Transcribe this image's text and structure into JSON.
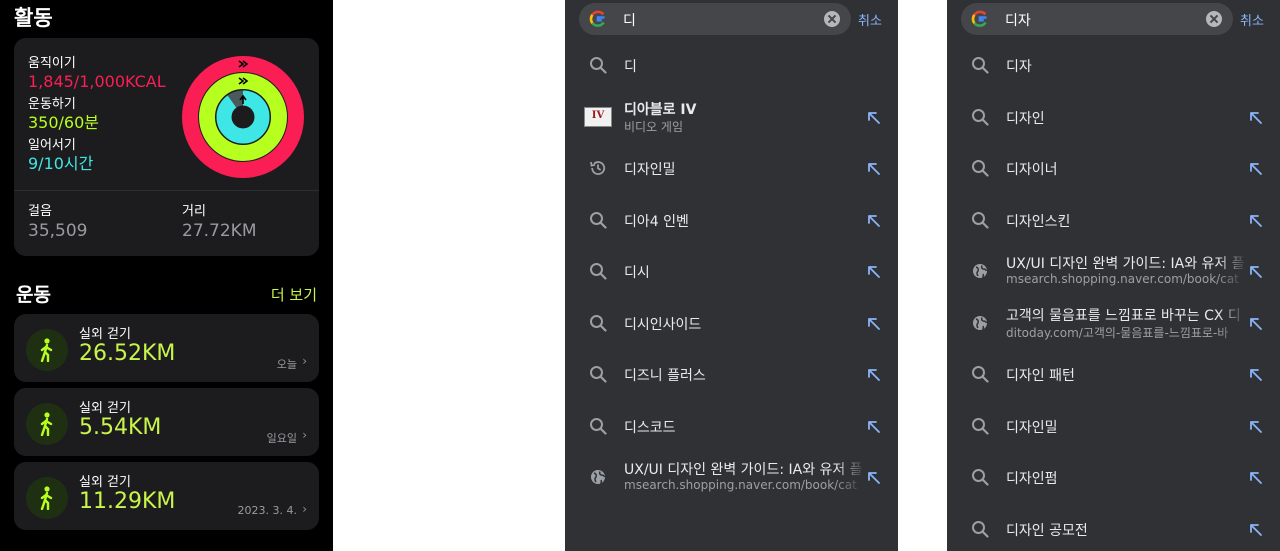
{
  "activity": {
    "title": "활동",
    "move": {
      "label": "움직이기",
      "value": "1,845/1,000KCAL",
      "color": "#fa1e55"
    },
    "exercise": {
      "label": "운동하기",
      "value": "350/60분",
      "color": "#b6ff1f"
    },
    "stand": {
      "label": "일어서기",
      "value": "9/10시간",
      "color": "#3fe6e6"
    },
    "steps": {
      "label": "걸음",
      "value": "35,509"
    },
    "distance": {
      "label": "거리",
      "value": "27.72KM"
    }
  },
  "workouts": {
    "title": "운동",
    "more": "더 보기",
    "items": [
      {
        "name": "실외 걷기",
        "distance": "26.52KM",
        "date": "오늘"
      },
      {
        "name": "실외 걷기",
        "distance": "5.54KM",
        "date": "일요일"
      },
      {
        "name": "실외 걷기",
        "distance": "11.29KM",
        "date": "2023. 3. 4."
      }
    ]
  },
  "search1": {
    "query": "디",
    "cancel": "취소",
    "suggestions": [
      {
        "icon": "search-icon",
        "text": "디"
      },
      {
        "icon": "thumbnail",
        "text": "디아블로 IV",
        "sub": "비디오 게임",
        "thumb_text": "IV"
      },
      {
        "icon": "history-icon",
        "text": "디자인밀"
      },
      {
        "icon": "search-icon",
        "text": "디아4 인벤"
      },
      {
        "icon": "search-icon",
        "text": "디시"
      },
      {
        "icon": "search-icon",
        "text": "디시인사이드"
      },
      {
        "icon": "search-icon",
        "text": "디즈니 플러스"
      },
      {
        "icon": "search-icon",
        "text": "디스코드"
      },
      {
        "icon": "globe-icon",
        "text": "UX/UI 디자인 완벽 가이드: IA와 유저 플",
        "sub": "msearch.shopping.naver.com/book/cat"
      }
    ]
  },
  "search2": {
    "query": "디자",
    "cancel": "취소",
    "suggestions": [
      {
        "icon": "search-icon",
        "text": "디자"
      },
      {
        "icon": "search-icon",
        "text": "디자인"
      },
      {
        "icon": "search-icon",
        "text": "디자이너"
      },
      {
        "icon": "search-icon",
        "text": "디자인스킨"
      },
      {
        "icon": "globe-icon",
        "text": "UX/UI 디자인 완벽 가이드: IA와 유저 플",
        "sub": "msearch.shopping.naver.com/book/cat"
      },
      {
        "icon": "globe-icon",
        "text": "고객의 물음표를 느낌표로 바꾸는 CX 디",
        "sub": "ditoday.com/고객의-물음표를-느낌표로-바"
      },
      {
        "icon": "search-icon",
        "text": "디자인 패턴"
      },
      {
        "icon": "search-icon",
        "text": "디자인밀"
      },
      {
        "icon": "search-icon",
        "text": "디자인펌"
      },
      {
        "icon": "search-icon",
        "text": "디자인 공모전"
      }
    ]
  }
}
